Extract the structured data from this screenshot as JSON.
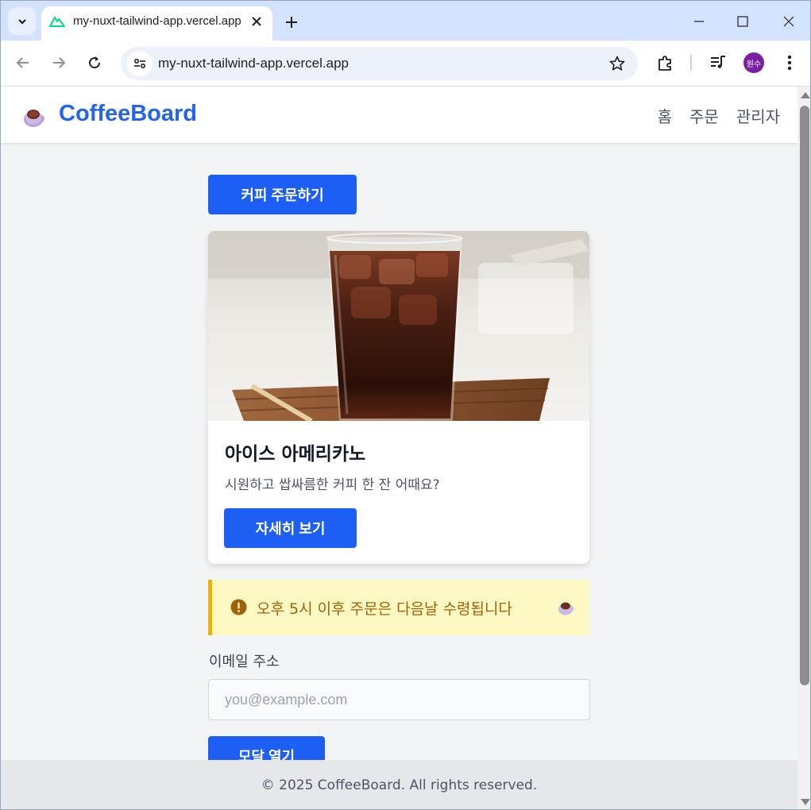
{
  "browser": {
    "tab_title": "my-nuxt-tailwind-app.vercel.app",
    "url": "my-nuxt-tailwind-app.vercel.app",
    "profile_initials": "원수",
    "profile_color": "#7b1fa2"
  },
  "header": {
    "brand": "CoffeeBoard",
    "nav": [
      "홈",
      "주문",
      "관리자"
    ],
    "brand_color": "#2563eb"
  },
  "main": {
    "order_button": "커피 주문하기",
    "card": {
      "title": "아이스 아메리카노",
      "description": "시원하고 쌉싸름한 커피 한 잔 어때요?",
      "button": "자세히 보기"
    },
    "notice": {
      "text": "오후 5시 이후 주문은 다음날 수령됩니다",
      "icon": "exclamation-circle-icon"
    },
    "email": {
      "label": "이메일 주소",
      "placeholder": "you@example.com",
      "value": ""
    },
    "modal_button": "모달 열기"
  },
  "footer": {
    "text": "© 2025 CoffeeBoard. All rights reserved."
  },
  "colors": {
    "primary_button": "#1d5ff5",
    "notice_background": "#fef9c3",
    "notice_border": "#eab308",
    "notice_text": "#a16207"
  }
}
